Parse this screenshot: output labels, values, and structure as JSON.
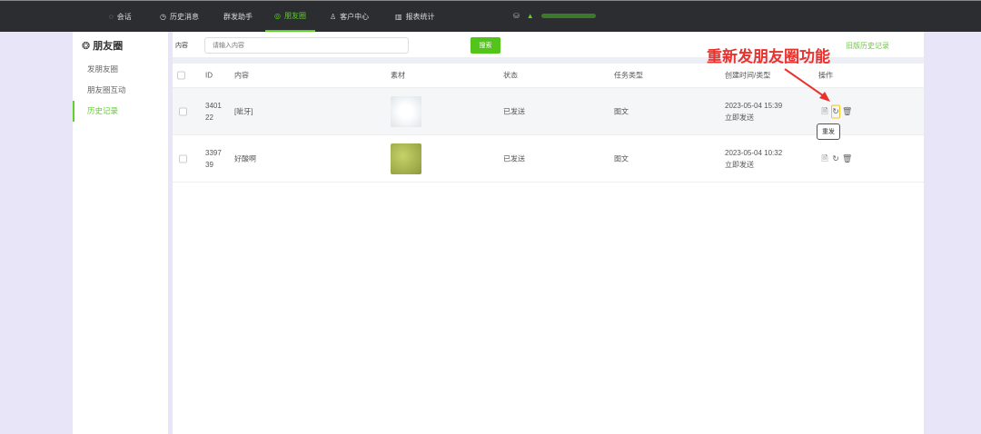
{
  "nav": [
    {
      "label": "会话",
      "icon": "chat-icon"
    },
    {
      "label": "历史消息",
      "icon": "clock-icon"
    },
    {
      "label": "群发助手",
      "icon": ""
    },
    {
      "label": "朋友圈",
      "icon": "moments-icon",
      "active": true
    },
    {
      "label": "客户中心",
      "icon": "user-icon"
    },
    {
      "label": "报表统计",
      "icon": "chart-icon"
    }
  ],
  "sidebar": {
    "title": "朋友圈",
    "items": [
      {
        "label": "发朋友圈"
      },
      {
        "label": "朋友圈互动"
      },
      {
        "label": "历史记录",
        "active": true
      }
    ]
  },
  "search": {
    "label": "内容",
    "placeholder": "请输入内容",
    "button": "搜索",
    "old_link": "旧版历史记录"
  },
  "table": {
    "headers": [
      "ID",
      "内容",
      "素材",
      "状态",
      "任务类型",
      "创建时间/类型",
      "操作"
    ],
    "rows": [
      {
        "id": "340122",
        "id1": "3401",
        "id2": "22",
        "content": "[呲牙]",
        "status": "已发送",
        "type": "图文",
        "time": "2023-05-04 15:39",
        "mode": "立即发送",
        "thumb": "#e8ecef"
      },
      {
        "id": "339739",
        "id1": "3397",
        "id2": "39",
        "content": "好酸啊",
        "status": "已发送",
        "type": "图文",
        "time": "2023-05-04 10:32",
        "mode": "立即发送",
        "thumb": "#a9b64a"
      }
    ]
  },
  "tooltip": "重发",
  "annotation": "重新发朋友圈功能",
  "colors": {
    "accent": "#52c41a",
    "topbar": "#2b2d31",
    "annotation": "#e8322d"
  }
}
